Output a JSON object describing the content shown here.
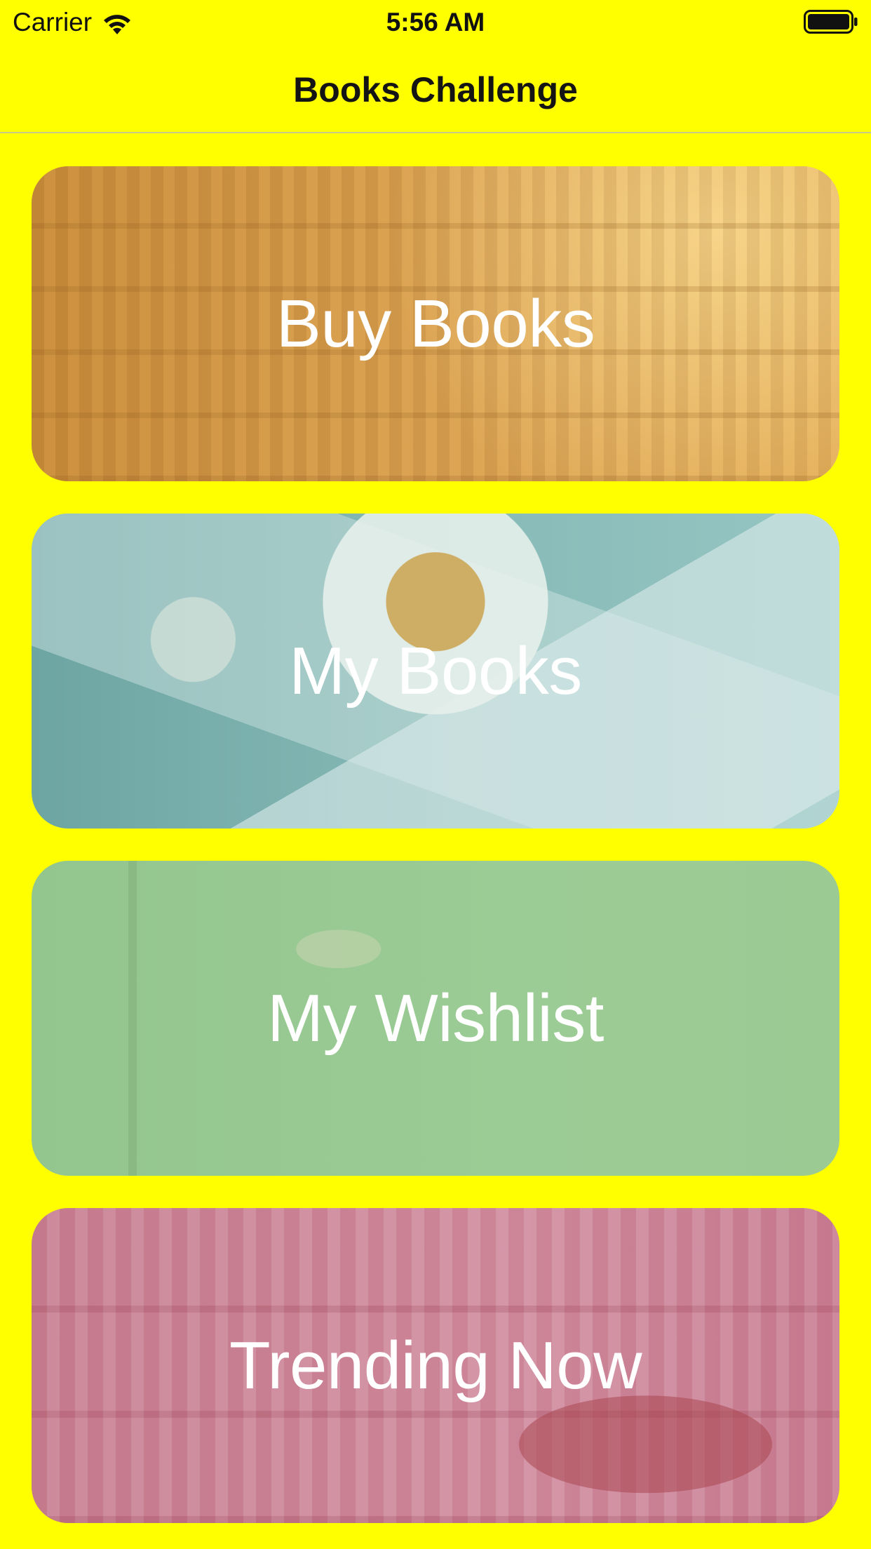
{
  "status_bar": {
    "carrier": "Carrier",
    "time": "5:56 AM",
    "wifi_icon": "wifi-icon",
    "battery_icon": "battery-icon"
  },
  "nav_bar": {
    "title": "Books Challenge"
  },
  "cards": [
    {
      "label": "Buy Books",
      "tint": "#dca556"
    },
    {
      "label": "My Books",
      "tint": "#86b9b6"
    },
    {
      "label": "My Wishlist",
      "tint": "#9ccc95"
    },
    {
      "label": "Trending Now",
      "tint": "#c37a8c"
    }
  ],
  "colors": {
    "background": "#ffff00",
    "label_text": "#ffffff",
    "title_text": "#141414"
  }
}
